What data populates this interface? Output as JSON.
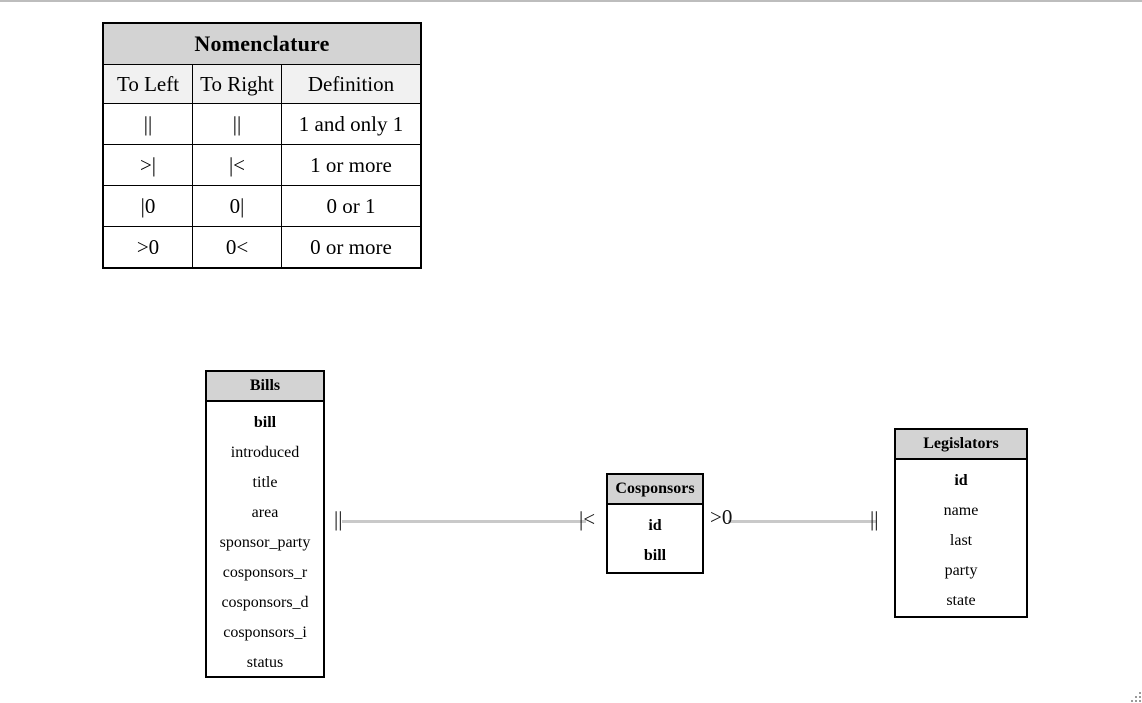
{
  "page": {
    "background_color": "#ffffff",
    "header_fill": "#d3d3d3",
    "subheader_fill": "#f1f1f1",
    "border_color": "#000000",
    "connector_color": "#c9c9c9"
  },
  "nomenclature": {
    "title": "Nomenclature",
    "columns": [
      "To Left",
      "To Right",
      "Definition"
    ],
    "rows": [
      {
        "to_left": "||",
        "to_right": "||",
        "definition": "1 and only 1"
      },
      {
        "to_left": ">|",
        "to_right": "|<",
        "definition": "1 or more"
      },
      {
        "to_left": "|0",
        "to_right": "0|",
        "definition": "0 or 1"
      },
      {
        "to_left": ">0",
        "to_right": "0<",
        "definition": "0 or more"
      }
    ]
  },
  "entities": [
    {
      "name": "Bills",
      "fields": [
        {
          "label": "bill",
          "key": true
        },
        {
          "label": "introduced",
          "key": false
        },
        {
          "label": "title",
          "key": false
        },
        {
          "label": "area",
          "key": false
        },
        {
          "label": "sponsor_party",
          "key": false
        },
        {
          "label": "cosponsors_r",
          "key": false
        },
        {
          "label": "cosponsors_d",
          "key": false
        },
        {
          "label": "cosponsors_i",
          "key": false
        },
        {
          "label": "status",
          "key": false
        }
      ]
    },
    {
      "name": "Cosponsors",
      "fields": [
        {
          "label": "id",
          "key": true
        },
        {
          "label": "bill",
          "key": true
        }
      ]
    },
    {
      "name": "Legislators",
      "fields": [
        {
          "label": "id",
          "key": true
        },
        {
          "label": "name",
          "key": false
        },
        {
          "label": "last",
          "key": false
        },
        {
          "label": "party",
          "key": false
        },
        {
          "label": "state",
          "key": false
        }
      ]
    }
  ],
  "relationships": [
    {
      "from": "Bills",
      "to": "Cosponsors",
      "from_cardinality": "||",
      "to_cardinality": "|<"
    },
    {
      "from": "Cosponsors",
      "to": "Legislators",
      "from_cardinality": ">0",
      "to_cardinality": "||"
    }
  ]
}
